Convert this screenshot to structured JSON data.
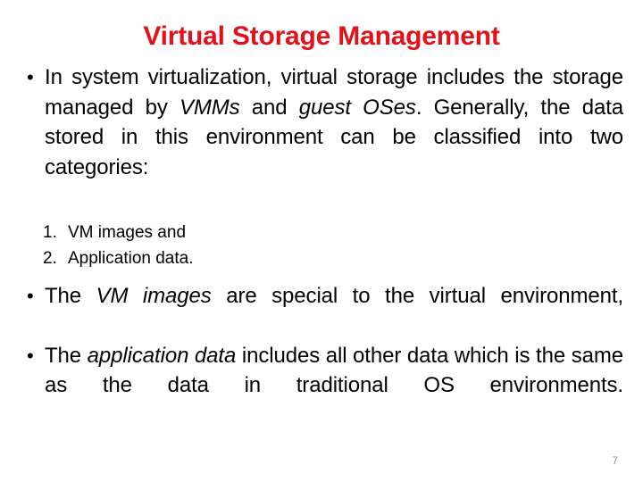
{
  "slide": {
    "title": "Virtual Storage Management",
    "title_color": "#e2121a",
    "background_color": "#ffffff",
    "text_color": "#000000",
    "page_number": "7",
    "page_number_color": "#9a9a9a"
  },
  "bullets": [
    {
      "marker": "•",
      "segments": [
        {
          "text": "In system virtualization, virtual storage includes the storage managed by ",
          "style": "normal"
        },
        {
          "text": "VMMs",
          "style": "italic"
        },
        {
          "text": " and ",
          "style": "normal"
        },
        {
          "text": "guest OSes",
          "style": "italic"
        },
        {
          "text": ". Generally, the data stored in this environment can be classified into two categories:",
          "style": "normal"
        }
      ]
    },
    {
      "marker": "•",
      "segments": [
        {
          "text": "The ",
          "style": "normal"
        },
        {
          "text": "VM images",
          "style": "italic"
        },
        {
          "text": " are special to the virtual environment,",
          "style": "normal"
        }
      ]
    },
    {
      "marker": "•",
      "segments": [
        {
          "text": "The ",
          "style": "normal"
        },
        {
          "text": "application data",
          "style": "italic"
        },
        {
          "text": " includes all other data which is the same as the data in traditional OS environments.",
          "style": "normal"
        }
      ]
    }
  ],
  "numbered_list": [
    {
      "number": "1.",
      "text": "VM images and"
    },
    {
      "number": "2.",
      "text": "Application data."
    }
  ]
}
